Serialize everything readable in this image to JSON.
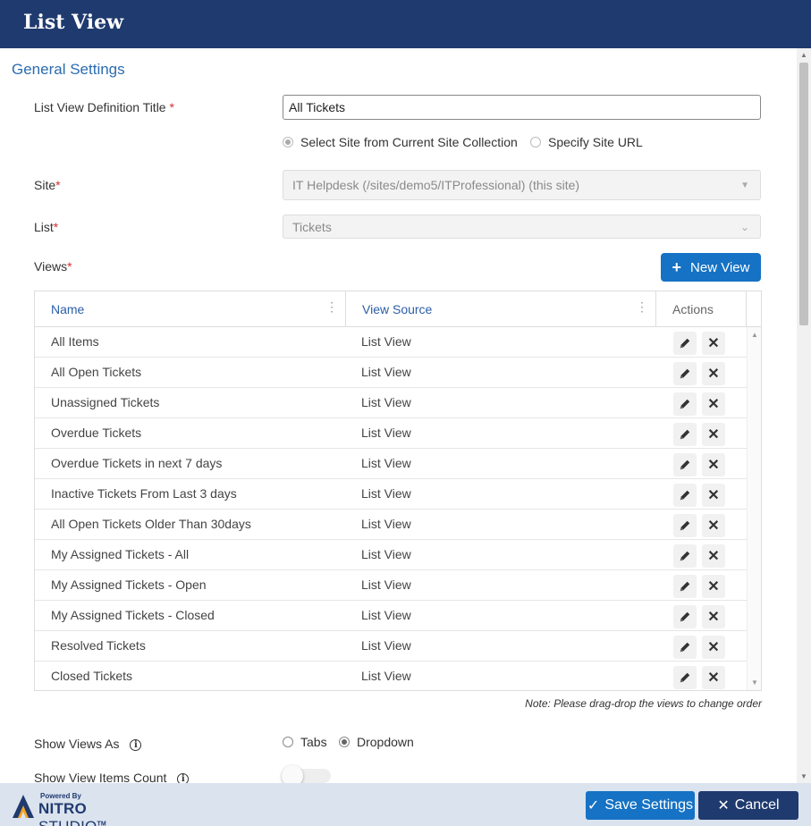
{
  "window": {
    "title": "List View"
  },
  "section": {
    "title": "General Settings"
  },
  "form": {
    "title_label": "List View Definition Title",
    "title_required": "*",
    "title_value": "All Tickets",
    "site_option_current": "Select Site from Current Site Collection",
    "site_option_url": "Specify Site URL",
    "site_label": "Site",
    "site_required": "*",
    "site_value": "IT Helpdesk (/sites/demo5/ITProfessional) (this site)",
    "list_label": "List",
    "list_required": "*",
    "list_value": "Tickets",
    "views_label": "Views",
    "views_required": "*",
    "new_view_label": "New View",
    "show_views_as_label": "Show Views As",
    "show_views_as_option_tabs": "Tabs",
    "show_views_as_option_dropdown": "Dropdown",
    "show_count_label": "Show View Items Count"
  },
  "grid": {
    "columns": [
      "Name",
      "View Source",
      "Actions"
    ],
    "rows": [
      {
        "name": "All Items",
        "source": "List View"
      },
      {
        "name": "All Open Tickets",
        "source": "List View"
      },
      {
        "name": "Unassigned Tickets",
        "source": "List View"
      },
      {
        "name": "Overdue Tickets",
        "source": "List View"
      },
      {
        "name": "Overdue Tickets in next 7 days",
        "source": "List View"
      },
      {
        "name": "Inactive Tickets From Last 3 days",
        "source": "List View"
      },
      {
        "name": "All Open Tickets Older Than 30days",
        "source": "List View"
      },
      {
        "name": "My Assigned Tickets - All",
        "source": "List View"
      },
      {
        "name": "My Assigned Tickets - Open",
        "source": "List View"
      },
      {
        "name": "My Assigned Tickets - Closed",
        "source": "List View"
      },
      {
        "name": "Resolved Tickets",
        "source": "List View"
      },
      {
        "name": "Closed Tickets",
        "source": "List View"
      }
    ],
    "note": "Note: Please drag-drop the views to change order"
  },
  "footer": {
    "powered_by": "Powered By",
    "brand_nitro": "NITRO",
    "brand_studio": "STUDIO",
    "brand_tm": "TM",
    "save_label": "Save Settings",
    "cancel_label": "Cancel"
  },
  "colors": {
    "header_bg": "#1f3a6e",
    "primary": "#1672c4",
    "link": "#2b5ea7",
    "required": "#d32f2f",
    "footer_bg": "#dbe3ef"
  },
  "icons": {
    "edit": "pencil-icon",
    "delete": "close-icon",
    "info": "info-icon",
    "save": "check-icon",
    "cancel": "x-icon",
    "new": "plus-icon"
  }
}
